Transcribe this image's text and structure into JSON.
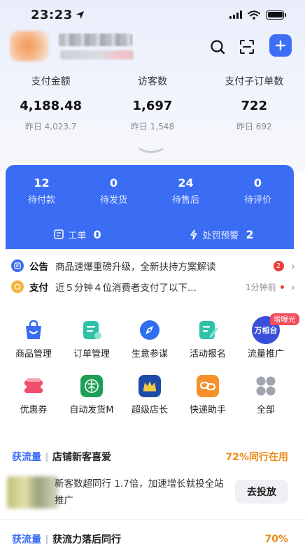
{
  "status_bar": {
    "time": "23:23"
  },
  "stats": [
    {
      "label": "支付金额",
      "value": "4,188.48",
      "prev": "昨日 4,023.7"
    },
    {
      "label": "访客数",
      "value": "1,697",
      "prev": "昨日 1,548"
    },
    {
      "label": "支付子订单数",
      "value": "722",
      "prev": "昨日 692"
    }
  ],
  "orders": [
    {
      "value": "12",
      "label": "待付款"
    },
    {
      "value": "0",
      "label": "待发货"
    },
    {
      "value": "24",
      "label": "待售后"
    },
    {
      "value": "0",
      "label": "待评价"
    }
  ],
  "work_order": {
    "label": "工单",
    "count": "0"
  },
  "penalty": {
    "label": "处罚预警",
    "count": "2"
  },
  "notices": [
    {
      "tag": "公告",
      "text": "商品速爆重磅升级，全新扶持方案解读",
      "badge": "2"
    },
    {
      "tag": "支付",
      "text": "近５分钟４位消费者支付了以下...",
      "time": "1分钟前"
    }
  ],
  "tools": [
    {
      "label": "商品管理",
      "icon": "shopping-bag-icon",
      "color": "#3a6cf4"
    },
    {
      "label": "订单管理",
      "icon": "order-list-icon",
      "color": "#2fc2a8"
    },
    {
      "label": "生意参谋",
      "icon": "compass-icon",
      "color": "#2f6ef0"
    },
    {
      "label": "活动报名",
      "icon": "edit-form-icon",
      "color": "#2fc2a8"
    },
    {
      "label": "流量推广",
      "icon": "wanxiangtai-icon",
      "color": "#3a4fd8",
      "badge": "增曝光",
      "brand": "万相台"
    },
    {
      "label": "优惠券",
      "icon": "coupon-icon",
      "color": "#f04e6a"
    },
    {
      "label": "自动发货M",
      "icon": "auto-ship-icon",
      "color": "#1f9e55"
    },
    {
      "label": "超级店长",
      "icon": "crown-icon",
      "color": "#1c4ca8"
    },
    {
      "label": "快递助手",
      "icon": "link-icon",
      "color": "#f5912b"
    },
    {
      "label": "全部",
      "icon": "grid-dots-icon",
      "color": "#a0a4ad"
    }
  ],
  "traffic1": {
    "tag": "获流量",
    "title": "店铺新客喜爱",
    "right": "72%同行在用"
  },
  "recommendation": {
    "text": "新客数超同行 1.7倍，加速增长就投全站推广",
    "button": "去投放"
  },
  "traffic2": {
    "tag": "获流量",
    "title": "获流力落后同行",
    "right": "70%"
  }
}
